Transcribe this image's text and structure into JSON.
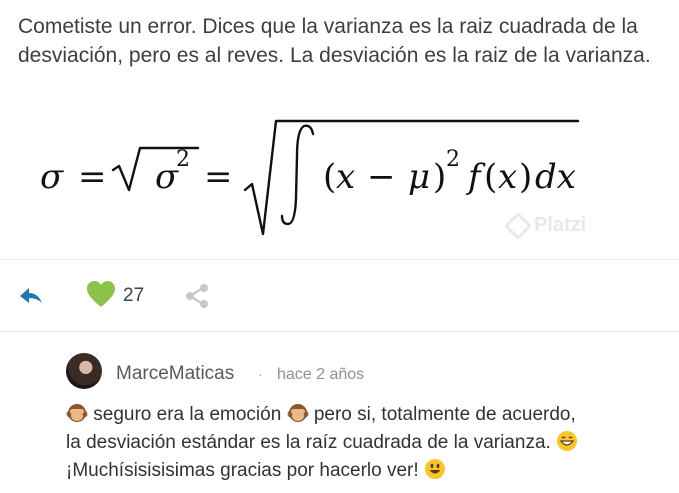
{
  "comment": {
    "text": "Cometiste un error. Dices que la varianza es la raiz cuadrada de la desviación, pero es al reves. La desviación es la raiz de la varianza."
  },
  "watermark": {
    "text": "Platzi"
  },
  "actions": {
    "like_count": "27",
    "like_color": "#8bc34a",
    "reply_color": "#1f78b4"
  },
  "reply": {
    "username": "MarceMaticas",
    "separator": "·",
    "time": "hace 2 años",
    "line1_a": "seguro era la emoción",
    "line1_b": "pero si, totalmente de acuerdo,",
    "line2": "la desviación estándar es la raíz cuadrada de la varianza.",
    "line3": "¡Muchísisisisimas gracias por hacerlo ver!"
  }
}
